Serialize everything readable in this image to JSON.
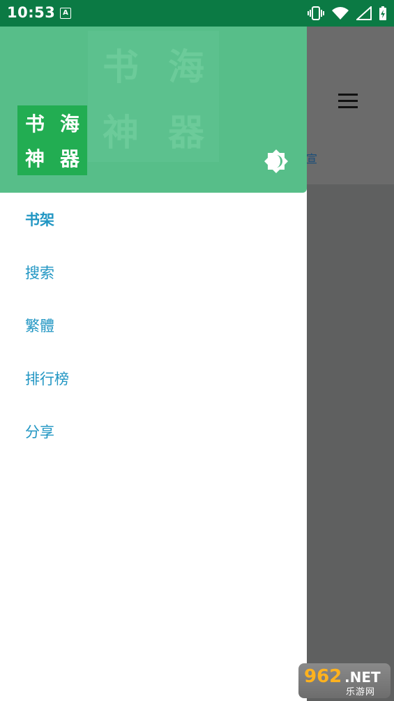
{
  "status_bar": {
    "time": "10:53",
    "notify_letter": "A"
  },
  "logo": {
    "chars": [
      "书",
      "海",
      "神",
      "器"
    ]
  },
  "watermark": {
    "chars": [
      "书",
      "海",
      "神",
      "器"
    ]
  },
  "menu": {
    "items": [
      {
        "label": "书架",
        "active": true
      },
      {
        "label": "搜索"
      },
      {
        "label": "繁體"
      },
      {
        "label": "排行榜"
      },
      {
        "label": "分享"
      }
    ]
  },
  "background": {
    "partial_link": "宣"
  },
  "badge": {
    "num": "962",
    "net": ".NET",
    "site": "乐游网"
  },
  "colors": {
    "status_bar": "#0b7a44",
    "header": "#57be89",
    "logo": "#22ad52",
    "accent": "#2196c3"
  },
  "icons": [
    "vibrate-icon",
    "wifi-icon",
    "signal-icon",
    "battery-charging-icon",
    "brightness-icon",
    "hamburger-menu-icon"
  ]
}
